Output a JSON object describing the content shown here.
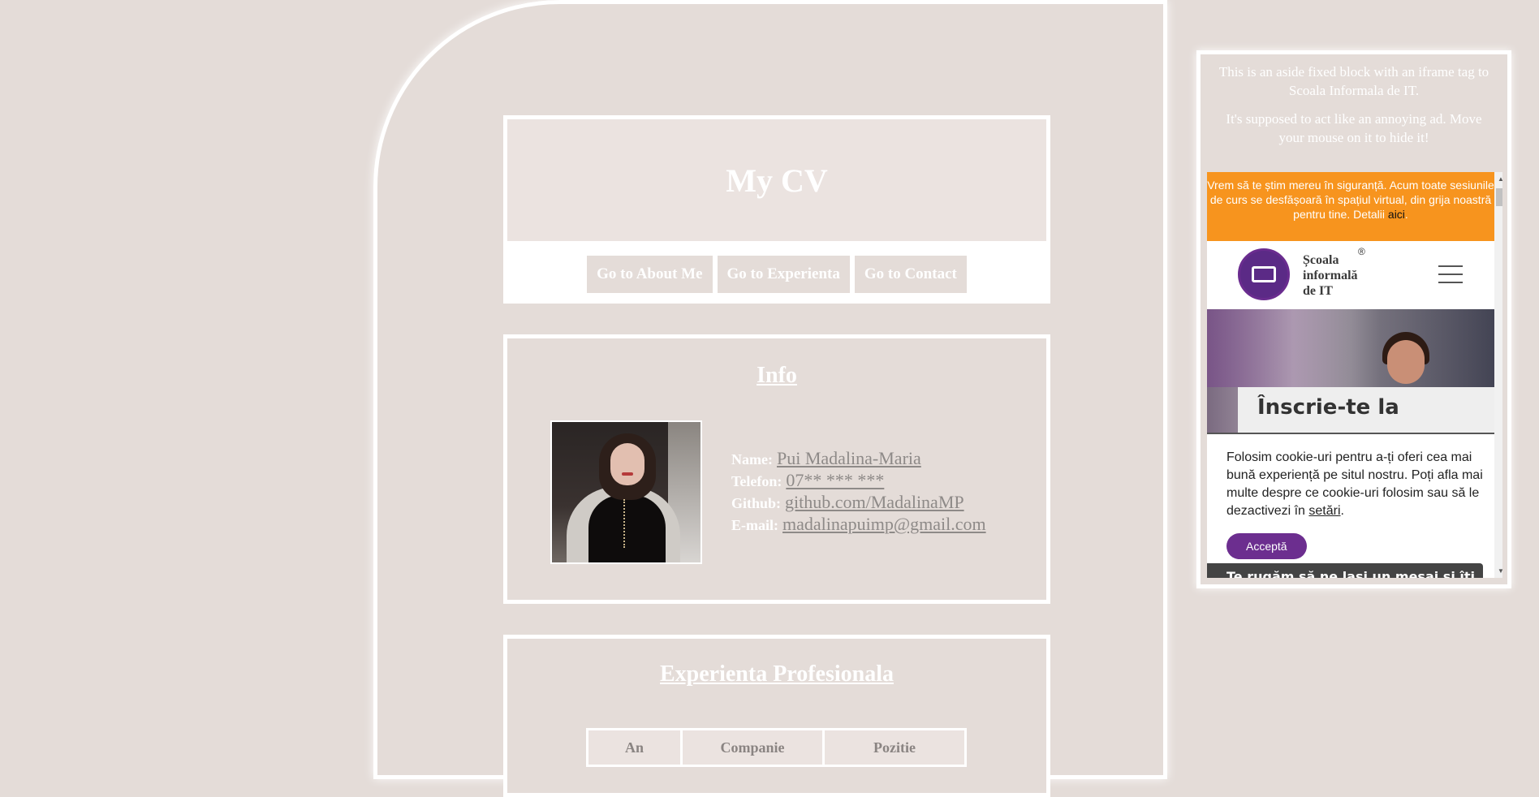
{
  "header": {
    "title": "My CV",
    "nav": [
      "Go to About Me",
      "Go to Experienta",
      "Go to Contact"
    ]
  },
  "info": {
    "title": "Info",
    "rows": [
      {
        "label": "Name:",
        "value": "Pui Madalina-Maria"
      },
      {
        "label": "Telefon:",
        "value": "07** *** ***"
      },
      {
        "label": "Github:",
        "value": "github.com/MadalinaMP"
      },
      {
        "label": "E-mail:",
        "value": "madalinapuimp@gmail.com"
      }
    ]
  },
  "experience": {
    "title": "Experienta Profesionala",
    "columns": [
      "An",
      "Companie",
      "Pozitie"
    ]
  },
  "aside": {
    "text1": "This is an aside fixed block with an iframe tag to Scoala Informala de IT.",
    "text2": "It's supposed to act like an annoying ad. Move your mouse on it to hide it!",
    "iframe": {
      "banner_text": "Vrem să te știm mereu în siguranță. Acum toate sesiunile de curs se desfășoară în spațiul virtual, din grija noastră pentru tine. Detalii",
      "banner_link": "aici",
      "banner_end": ".",
      "logo_line1": "Școala",
      "logo_line2": "informală",
      "logo_line3": "de IT",
      "registered": "®",
      "hero_text": "Înscrie-te la",
      "cookie_text": "Folosim cookie-uri pentru a-ți oferi cea mai bună experiență pe situl nostru. Poți afla mai multe despre ce cookie-uri folosim sau să le dezactivezi în",
      "cookie_link": "setări",
      "cookie_end": ".",
      "accept": "Acceptă",
      "message_bar": "Te rugăm să ne lași un mesaj și îți..."
    }
  }
}
